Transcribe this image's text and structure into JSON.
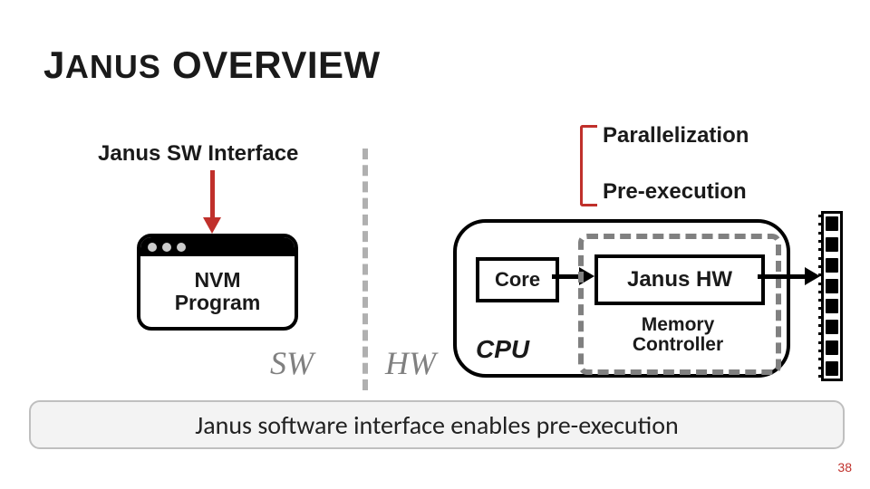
{
  "title": {
    "word1_rest": "ANUS",
    "word2": "OVERVIEW"
  },
  "labels": {
    "sw_interface": "Janus SW Interface",
    "parallelization": "Parallelization",
    "preexecution": "Pre-execution",
    "sw": "SW",
    "hw": "HW"
  },
  "boxes": {
    "nvm_program": "NVM\nProgram",
    "core": "Core",
    "cpu": "CPU",
    "janus_hw": "Janus HW",
    "memory_controller": "Memory\nController"
  },
  "caption": "Janus software interface enables pre-execution",
  "page": "38",
  "colors": {
    "accent_red": "#c0302b",
    "divider_gray": "#b0b0b0",
    "dash_gray": "#808080",
    "caption_bg": "#f3f3f3",
    "caption_border": "#bfbfbf"
  }
}
